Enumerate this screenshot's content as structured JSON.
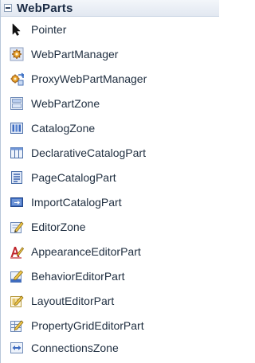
{
  "toolbox": {
    "group_title": "WebParts",
    "items": [
      {
        "label": "Pointer",
        "icon": "pointer-icon"
      },
      {
        "label": "WebPartManager",
        "icon": "webpartmanager-icon"
      },
      {
        "label": "ProxyWebPartManager",
        "icon": "proxywebpartmanager-icon"
      },
      {
        "label": "WebPartZone",
        "icon": "webpartzone-icon"
      },
      {
        "label": "CatalogZone",
        "icon": "catalogzone-icon"
      },
      {
        "label": "DeclarativeCatalogPart",
        "icon": "declarativecatalogpart-icon"
      },
      {
        "label": "PageCatalogPart",
        "icon": "pagecatalogpart-icon"
      },
      {
        "label": "ImportCatalogPart",
        "icon": "importcatalogpart-icon"
      },
      {
        "label": "EditorZone",
        "icon": "editorzone-icon"
      },
      {
        "label": "AppearanceEditorPart",
        "icon": "appearanceeditorpart-icon"
      },
      {
        "label": "BehaviorEditorPart",
        "icon": "behavioreditorpart-icon"
      },
      {
        "label": "LayoutEditorPart",
        "icon": "layouteditorpart-icon"
      },
      {
        "label": "PropertyGridEditorPart",
        "icon": "propertygrideditorpart-icon"
      },
      {
        "label": "ConnectionsZone",
        "icon": "connectionszone-icon"
      }
    ]
  }
}
